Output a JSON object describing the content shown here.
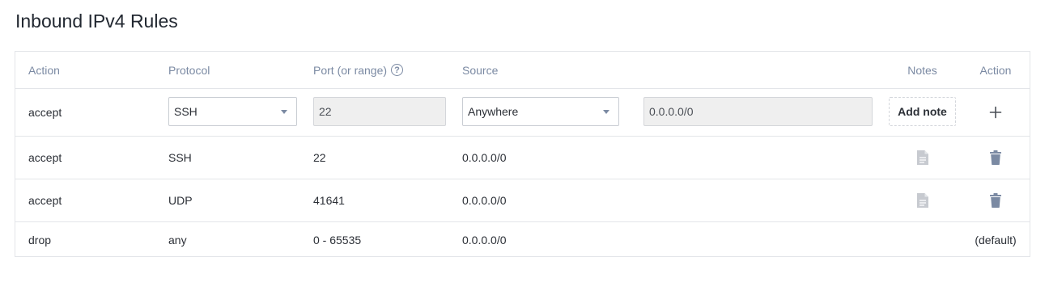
{
  "page_title": "Inbound IPv4 Rules",
  "headers": {
    "action": "Action",
    "protocol": "Protocol",
    "port": "Port (or range)",
    "port_help": "?",
    "source": "Source",
    "notes": "Notes",
    "action2": "Action"
  },
  "new_rule": {
    "action": "accept",
    "protocol_selected": "SSH",
    "port_value": "22",
    "source_selected": "Anywhere",
    "source_value": "0.0.0.0/0",
    "add_note_label": "Add note",
    "add_icon": "plus-icon"
  },
  "rules": [
    {
      "action": "accept",
      "protocol": "SSH",
      "port": "22",
      "source": "0.0.0.0/0",
      "note_icon": "document-icon",
      "action_icon": "trash-icon"
    },
    {
      "action": "accept",
      "protocol": "UDP",
      "port": "41641",
      "source": "0.0.0.0/0",
      "note_icon": "document-icon",
      "action_icon": "trash-icon"
    }
  ],
  "default_rule": {
    "action": "drop",
    "protocol": "any",
    "port": "0 - 65535",
    "source": "0.0.0.0/0",
    "action_label": "(default)"
  },
  "colors": {
    "header_text": "#7b8aa3",
    "icon_trash": "#7b8aa3",
    "icon_note": "#c7cad0",
    "border": "#e3e5e9"
  }
}
